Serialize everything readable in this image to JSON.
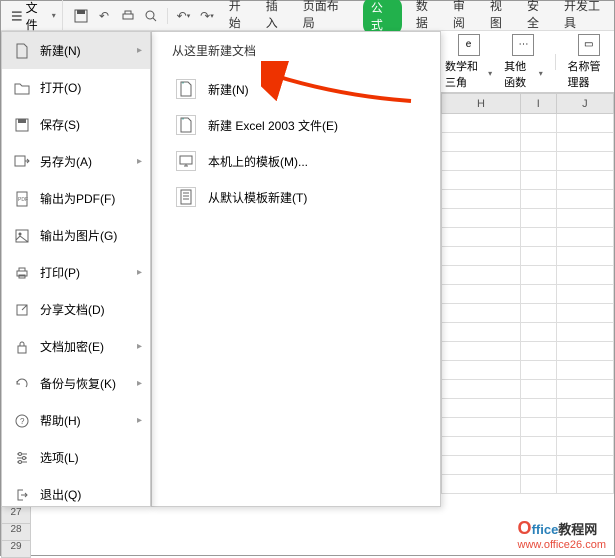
{
  "toolbar": {
    "file_label": "文件",
    "tabs": [
      "开始",
      "插入",
      "页面布局",
      "公式",
      "数据",
      "审阅",
      "视图",
      "安全",
      "开发工具"
    ],
    "active_tab_index": 3
  },
  "ribbon": {
    "btn1": "数学和三角",
    "btn2": "其他函数",
    "btn3": "名称管理器"
  },
  "file_menu": {
    "items": [
      {
        "label": "新建(N)",
        "has_arrow": true,
        "active": true
      },
      {
        "label": "打开(O)",
        "has_arrow": false
      },
      {
        "label": "保存(S)",
        "has_arrow": false
      },
      {
        "label": "另存为(A)",
        "has_arrow": true
      },
      {
        "label": "输出为PDF(F)",
        "has_arrow": false
      },
      {
        "label": "输出为图片(G)",
        "has_arrow": false
      },
      {
        "label": "打印(P)",
        "has_arrow": true
      },
      {
        "label": "分享文档(D)",
        "has_arrow": false
      },
      {
        "label": "文档加密(E)",
        "has_arrow": true
      },
      {
        "label": "备份与恢复(K)",
        "has_arrow": true
      },
      {
        "label": "帮助(H)",
        "has_arrow": true
      },
      {
        "label": "选项(L)",
        "has_arrow": false
      },
      {
        "label": "退出(Q)",
        "has_arrow": false
      }
    ]
  },
  "submenu": {
    "title": "从这里新建文档",
    "items": [
      {
        "label": "新建(N)"
      },
      {
        "label": "新建 Excel 2003 文件(E)"
      },
      {
        "label": "本机上的模板(M)..."
      },
      {
        "label": "从默认模板新建(T)"
      }
    ]
  },
  "sheet": {
    "columns": [
      "H",
      "I",
      "J"
    ]
  },
  "row_numbers": [
    "27",
    "28",
    "29"
  ],
  "watermark": {
    "brand_o": "O",
    "brand_rest": "ffice",
    "brand_cn": "教程网",
    "url": "www.office26.com"
  }
}
